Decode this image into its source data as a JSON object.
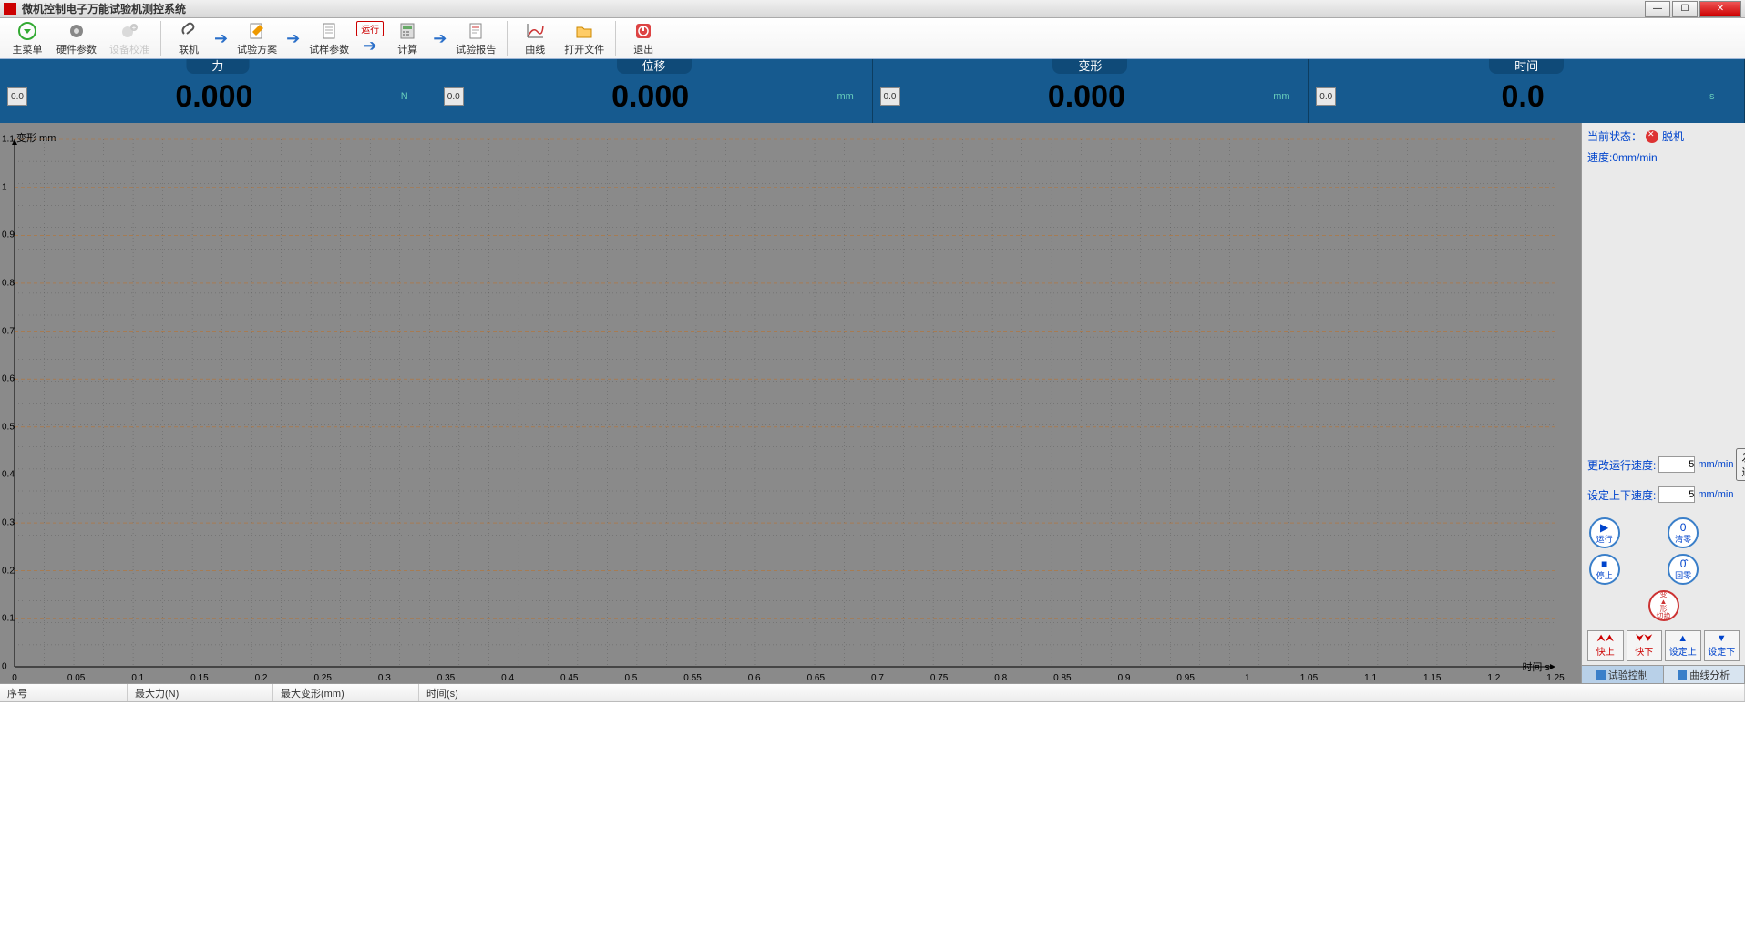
{
  "window": {
    "title": "微机控制电子万能试验机测控系统",
    "min": "—",
    "max": "☐",
    "close": "✕"
  },
  "toolbar": {
    "main_menu": "主菜单",
    "hw_params": "硬件参数",
    "dev_calib": "设备校准",
    "connect": "联机",
    "test_plan": "试验方案",
    "sample_params": "试样参数",
    "run_badge": "运行",
    "calc": "计算",
    "report": "试验报告",
    "curve": "曲线",
    "open_file": "打开文件",
    "exit": "退出"
  },
  "readouts": [
    {
      "label": "力",
      "zero": "0.0",
      "value": "0.000",
      "unit": "N"
    },
    {
      "label": "位移",
      "zero": "0.0",
      "value": "0.000",
      "unit": "mm"
    },
    {
      "label": "变形",
      "zero": "0.0",
      "value": "0.000",
      "unit": "mm"
    },
    {
      "label": "时间",
      "zero": "0.0",
      "value": "0.0",
      "unit": "s"
    }
  ],
  "chart": {
    "y_label": "变形 mm",
    "x_label": "时间 s",
    "y_ticks": [
      "0",
      "0.1",
      "0.2",
      "0.3",
      "0.4",
      "0.5",
      "0.6",
      "0.7",
      "0.8",
      "0.9",
      "1",
      "1.1"
    ],
    "x_ticks": [
      "0",
      "0.05",
      "0.1",
      "0.15",
      "0.2",
      "0.25",
      "0.3",
      "0.35",
      "0.4",
      "0.45",
      "0.5",
      "0.55",
      "0.6",
      "0.65",
      "0.7",
      "0.75",
      "0.8",
      "0.85",
      "0.9",
      "0.95",
      "1",
      "1.05",
      "1.1",
      "1.15",
      "1.2",
      "1.25"
    ]
  },
  "side": {
    "status_label": "当前状态：",
    "status_value": "脱机",
    "speed_label": "速度:",
    "speed_value": "0mm/min",
    "change_speed_label": "更改运行速度:",
    "change_speed_value": "5",
    "change_speed_unit": "mm/min",
    "send": "发送",
    "set_ud_label": "设定上下速度:",
    "set_ud_value": "5",
    "set_ud_unit": "mm/min",
    "btn_run": "运行",
    "btn_clear": "清零",
    "btn_stop": "停止",
    "btn_return": "回零",
    "btn_deform_switch_l1": "变",
    "btn_deform_switch_l2": "形",
    "btn_deform_switch_l3": "切换",
    "btn_fast_up": "快上",
    "btn_fast_down": "快下",
    "btn_set_up": "设定上",
    "btn_set_down": "设定下",
    "tab_control": "试验控制",
    "tab_analysis": "曲线分析"
  },
  "table": {
    "col_no": "序号",
    "col_maxforce": "最大力(N)",
    "col_maxdeform": "最大变形(mm)",
    "col_time": "时间(s)"
  }
}
